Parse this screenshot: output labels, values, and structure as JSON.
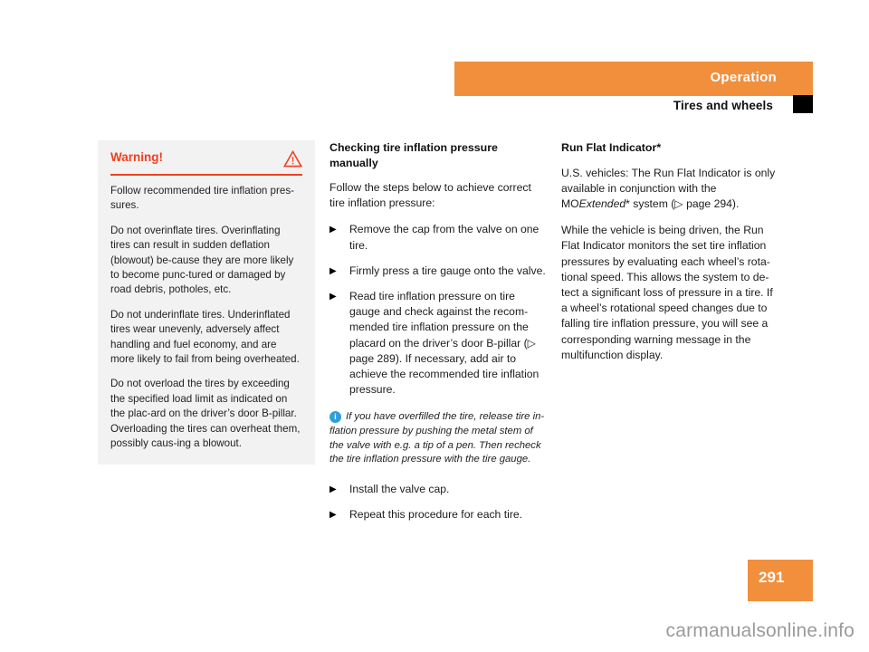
{
  "header": {
    "section_title": "Operation",
    "subtitle": "Tires and wheels"
  },
  "warning": {
    "title": "Warning!",
    "icon": "warning-triangle-icon",
    "paragraphs": [
      "Follow recommended tire inflation pres-sures.",
      "Do not overinflate tires. Overinflating tires can result in sudden deflation (blowout) be-cause they are more likely to become punc-tured or damaged by road debris, potholes, etc.",
      "Do not underinflate tires. Underinflated tires wear unevenly, adversely affect handling and fuel economy, and are more likely to fail from being overheated.",
      "Do not overload the tires by exceeding the specified load limit as indicated on the plac-ard on the driver’s door B-pillar. Overloading the tires can overheat them, possibly caus-ing a blowout."
    ]
  },
  "middle_column": {
    "heading": "Checking tire inflation pressure manually",
    "intro": "Follow the steps below to achieve correct tire inflation pressure:",
    "bullet_marker": "▶",
    "steps_top": [
      "Remove the cap from the valve on one tire.",
      "Firmly press a tire gauge onto the valve.",
      "Read tire inflation pressure on tire gauge and check against the recom-mended tire inflation pressure on the placard on the driver’s door B-pillar (▷ page 289). If necessary, add air to achieve the recommended tire inflation pressure."
    ],
    "note": {
      "icon": "info-circle-icon",
      "icon_glyph": "i",
      "text": "If you have overfilled the tire, release tire in-flation pressure by pushing the metal stem of the valve with e.g. a tip of a pen. Then recheck the tire inflation pressure with the tire gauge."
    },
    "steps_bottom": [
      "Install the valve cap.",
      "Repeat this procedure for each tire."
    ]
  },
  "right_column": {
    "heading": "Run Flat Indicator*",
    "para1_part1": "U.S. vehicles: The Run Flat Indicator is only available in conjunction with the MO",
    "para1_italic": "Extended",
    "para1_part2": "* system (▷ page 294).",
    "para2": "While the vehicle is being driven, the Run Flat Indicator monitors the set tire inflation pressures by evaluating each wheel’s rota-tional speed. This allows the system to de-tect a significant loss of pressure in a tire. If a wheel’s rotational speed changes due to falling tire inflation pressure, you will see a corresponding warning message in the multifunction display."
  },
  "footer": {
    "page_number": "291",
    "watermark": "carmanualsonline.info"
  },
  "colors": {
    "accent_orange": "#f18f3d",
    "warning_red": "#f04020",
    "info_blue": "#2e9fd6",
    "warning_box_bg": "#f2f2f2",
    "watermark_gray": "#9b9b9b"
  }
}
